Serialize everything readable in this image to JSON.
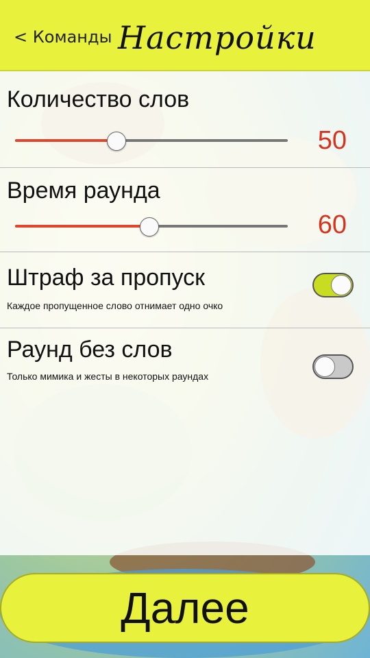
{
  "header": {
    "back_label": "< Команды",
    "title": "Настройки"
  },
  "settings": {
    "word_count": {
      "label": "Количество слов",
      "value": "50",
      "slider_fraction": 0.37
    },
    "round_time": {
      "label": "Время раунда",
      "value": "60",
      "slider_fraction": 0.49
    },
    "skip_penalty": {
      "label": "Штраф за пропуск",
      "description": "Каждое пропущенное слово отнимает одно очко",
      "enabled": true
    },
    "wordless_round": {
      "label": "Раунд без слов",
      "description": "Только мимика и жесты в некоторых раундах",
      "enabled": false
    }
  },
  "footer": {
    "next_label": "Далее"
  },
  "colors": {
    "accent_yellow": "#e8f23c",
    "value_red": "#d6331e",
    "slider_fill": "#e5442c"
  },
  "icons": {
    "back": "back-chevron-icon"
  }
}
